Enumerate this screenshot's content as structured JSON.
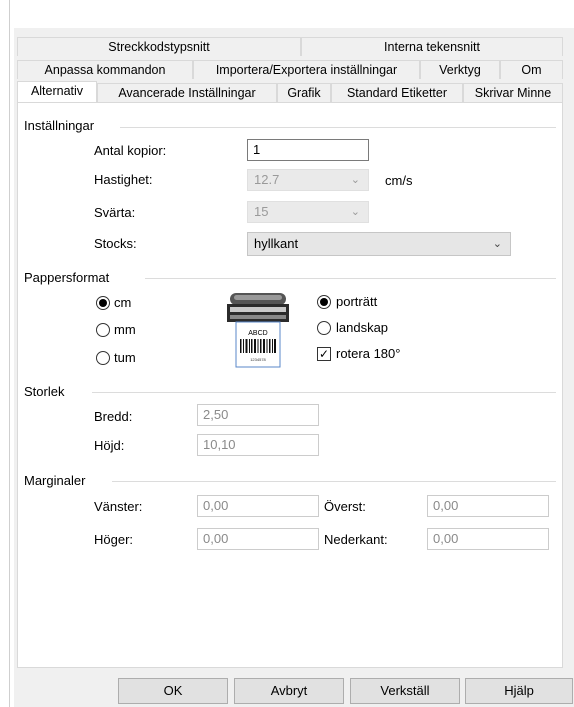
{
  "tabs_row1": [
    "Streckkodstypsnitt",
    "Interna tekensnitt"
  ],
  "tabs_row2": [
    "Anpassa kommandon",
    "Importera/Exportera inställningar",
    "Verktyg",
    "Om"
  ],
  "tabs_row3": [
    "Alternativ",
    "Avancerade Inställningar",
    "Grafik",
    "Standard Etiketter",
    "Skrivar Minne"
  ],
  "settings": {
    "group": "Inställningar",
    "copies_label": "Antal kopior:",
    "copies_value": "1",
    "speed_label": "Hastighet:",
    "speed_value": "12.7",
    "speed_unit": "cm/s",
    "darkness_label": "Svärta:",
    "darkness_value": "15",
    "stock_label": "Stocks:",
    "stock_value": "hyllkant"
  },
  "paper": {
    "group": "Pappersformat",
    "unit_cm": "cm",
    "unit_mm": "mm",
    "unit_tum": "tum",
    "selected_unit": "cm",
    "orient_portrait": "porträtt",
    "orient_landscape": "landskap",
    "selected_orientation": "porträtt",
    "rotate_label": "rotera 180°",
    "rotate_checked": true,
    "label_text": "ABCD",
    "label_number": "1234578"
  },
  "size": {
    "group": "Storlek",
    "width_label": "Bredd:",
    "width_value": "2,50",
    "height_label": "Höjd:",
    "height_value": "10,10"
  },
  "margins": {
    "group": "Marginaler",
    "left_label": "Vänster:",
    "left_value": "0,00",
    "top_label": "Överst:",
    "top_value": "0,00",
    "right_label": "Höger:",
    "right_value": "0,00",
    "bottom_label": "Nederkant:",
    "bottom_value": "0,00"
  },
  "buttons": {
    "ok": "OK",
    "cancel": "Avbryt",
    "apply": "Verkställ",
    "help": "Hjälp"
  },
  "icons": {
    "dropdown": "chevron-down-icon",
    "printer": "label-printer-icon"
  }
}
